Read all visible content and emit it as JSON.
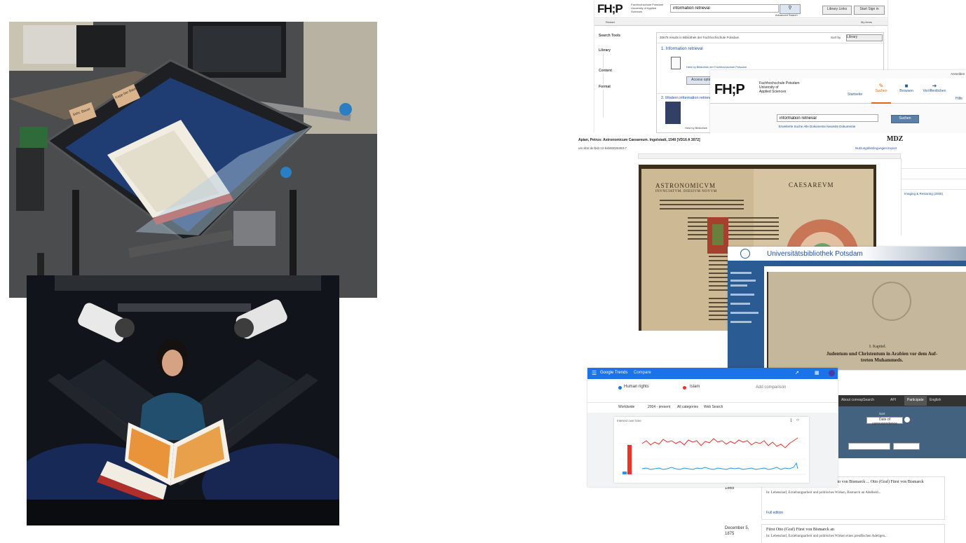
{
  "photo1": {
    "labels": [
      "Kapp ber Bauer",
      "Sehr. Bauer"
    ]
  },
  "fhp_catalog": {
    "logo": "FH;P",
    "logo_sub": "Fachhochschule Potsdam University of Applied Sciences",
    "search_value": "information retrieval",
    "advanced_search": "Advanced Search",
    "library_links": "Library Links",
    "sign_in": "Start Sign in",
    "my_items": "My items",
    "back_button": "Restart",
    "results_summary": "30675 results in Bibliothek der Fachhochschule Potsdam",
    "sort_label": "Sort by",
    "sort_value": "Library",
    "search_tools": "Search Tools",
    "facet_library": "Library",
    "facet_content": "Content",
    "facet_format": "Format",
    "result1_title": "1. Information retrieval",
    "result1_meta": "Held by Bibliothek der Fachhochschule Potsdam",
    "result1_action": "Access options",
    "result2_title": "2. Modern information retrieval",
    "result2_meta": "Held by Bibliothek"
  },
  "fhp_portal": {
    "top_right": "Anmelden",
    "logo": "FH;P",
    "name_line1": "Fachhochschule Potsdam",
    "name_line2": "University of",
    "name_line3": "Applied Sciences",
    "tabs": [
      "Startseite",
      "Suchen",
      "Browsen",
      "Veröffentlichen",
      "Hilfe"
    ],
    "search_value": "information retrieval",
    "search_button": "Suchen",
    "subline": "Erweiterte Suche  Alle Dokumente  Neueste Dokumente"
  },
  "mdz": {
    "title": "Apian, Petrus: Astronomicum Caesareum. Ingolstadt, 1540 [VD16 A 3072]",
    "url_line": "urn:nbn:de:bvb:12-bsb00026393-7",
    "logo": "MDZ",
    "top_right_links": "Nutzungsbedingungen  Export",
    "image_title_left": "ASTRONOMICVM",
    "image_title_left2": "INVNCIATVM. DIESIVM NOVVM",
    "image_title_right": "CAESAREVM",
    "side_item": "Imaging & Restoring (2005)"
  },
  "up": {
    "title": "Universitätsbibliothek Potsdam",
    "chapter": "I. Kapitel.",
    "heading_line1": "Judentum und Christentum in Arabien vor dem Auf-",
    "heading_line2": "treten Muhammeds."
  },
  "trends": {
    "header": "Google Trends",
    "header_sub": "Compare",
    "term1": "Human rights",
    "term2": "Islam",
    "add": "Add comparison",
    "filters": [
      "Worldwide",
      "2004 - present",
      "All categories",
      "Web Search"
    ],
    "chart_title": "Interest over time",
    "series_colors": {
      "term1": "#e8322e",
      "term2": "#2196f3"
    }
  },
  "archive": {
    "nav": [
      "About correspSearch",
      "API",
      "Participate",
      "English"
    ],
    "field_label": "Sort",
    "field_value": "Date of correspondence",
    "date1": "1865",
    "entry1_title": "Herbert von Bismarck-Schönhausen an Otto von Bismarck ... Otto (Graf) Fürst von Bismarck",
    "entry1_body": "In: Lebenslauf, Erziehungsarbeit und politisches Wirken, Bismarck an Adelheid...",
    "entry1_link": "Full edition",
    "date2": "December 5, 1875",
    "entry2_title": "Fürst Otto (Graf) Fürst von Bismarck an",
    "entry2_body": "In: Lebenslauf, Erziehungsarbeit und politisches Wirken eines preußischen Adeligen..."
  }
}
